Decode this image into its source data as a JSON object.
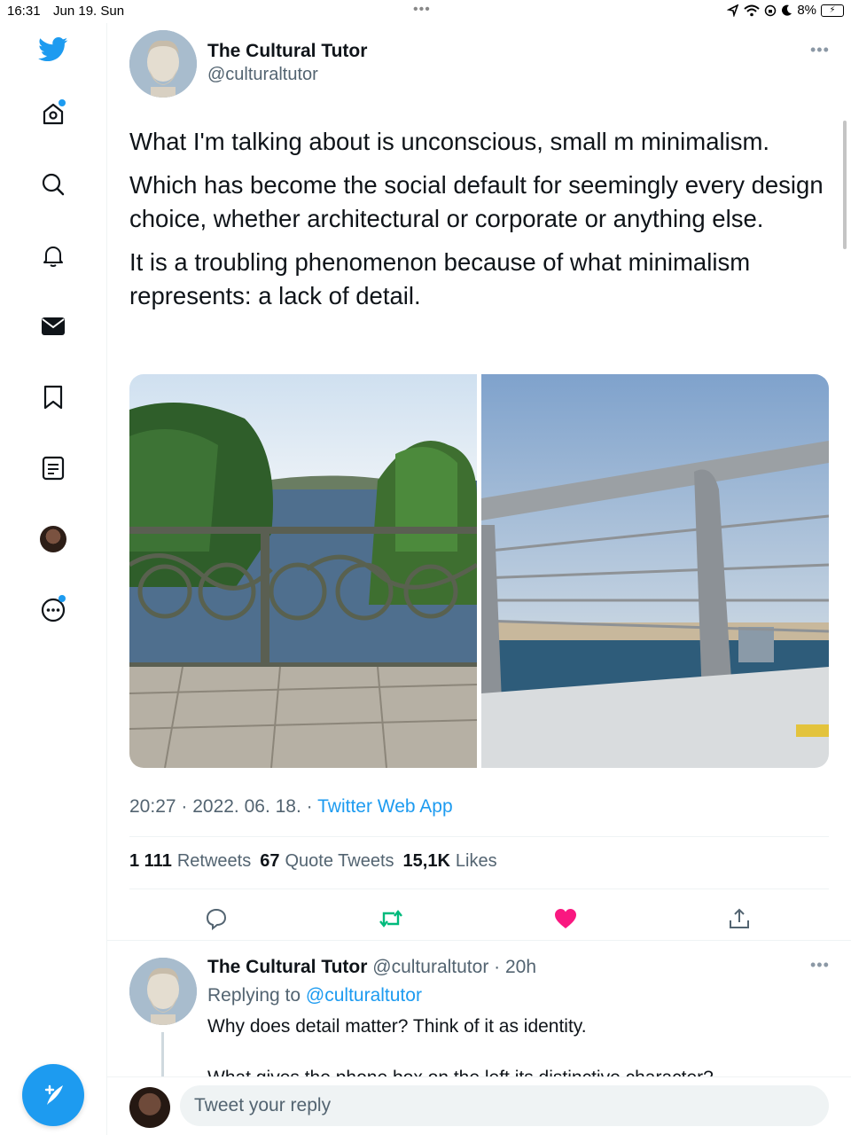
{
  "status_bar": {
    "time": "16:31",
    "date": "Jun 19. Sun",
    "battery": "8%"
  },
  "sidebar": {
    "items": [
      {
        "name": "twitter-logo-icon"
      },
      {
        "name": "home-icon"
      },
      {
        "name": "explore-icon"
      },
      {
        "name": "notifications-icon"
      },
      {
        "name": "messages-icon"
      },
      {
        "name": "bookmarks-icon"
      },
      {
        "name": "lists-icon"
      },
      {
        "name": "profile-avatar"
      },
      {
        "name": "more-icon"
      }
    ],
    "accent": "#1d9bf0"
  },
  "tweet": {
    "author_name": "The Cultural Tutor",
    "author_handle": "@culturaltutor",
    "paragraphs": [
      "What I'm talking about is unconscious, small m minimalism.",
      "Which has become the social default for seemingly every design choice, whether architectural or corporate or anything else.",
      "It is a troubling phenomenon because of what minimalism represents: a lack of detail."
    ],
    "timestamp": "20:27 · 2022. 06. 18. · ",
    "source": "Twitter Web App",
    "stats": {
      "retweets_count": "1 111",
      "retweets_label": "Retweets",
      "quotes_count": "67",
      "quotes_label": "Quote Tweets",
      "likes_count": "15,1K",
      "likes_label": "Likes"
    }
  },
  "reply": {
    "author_name": "The Cultural Tutor",
    "author_meta": " @culturaltutor · 20h",
    "replying_prefix": "Replying to ",
    "replying_handle": "@culturaltutor",
    "text": "Why does detail matter? Think of it as identity.",
    "text_cut": "What gives the phone box on the left its distinctive character?"
  },
  "composer": {
    "placeholder": "Tweet your reply"
  },
  "colors": {
    "like": "#f91880",
    "retweet": "#00ba7c",
    "link": "#1d9bf0"
  }
}
